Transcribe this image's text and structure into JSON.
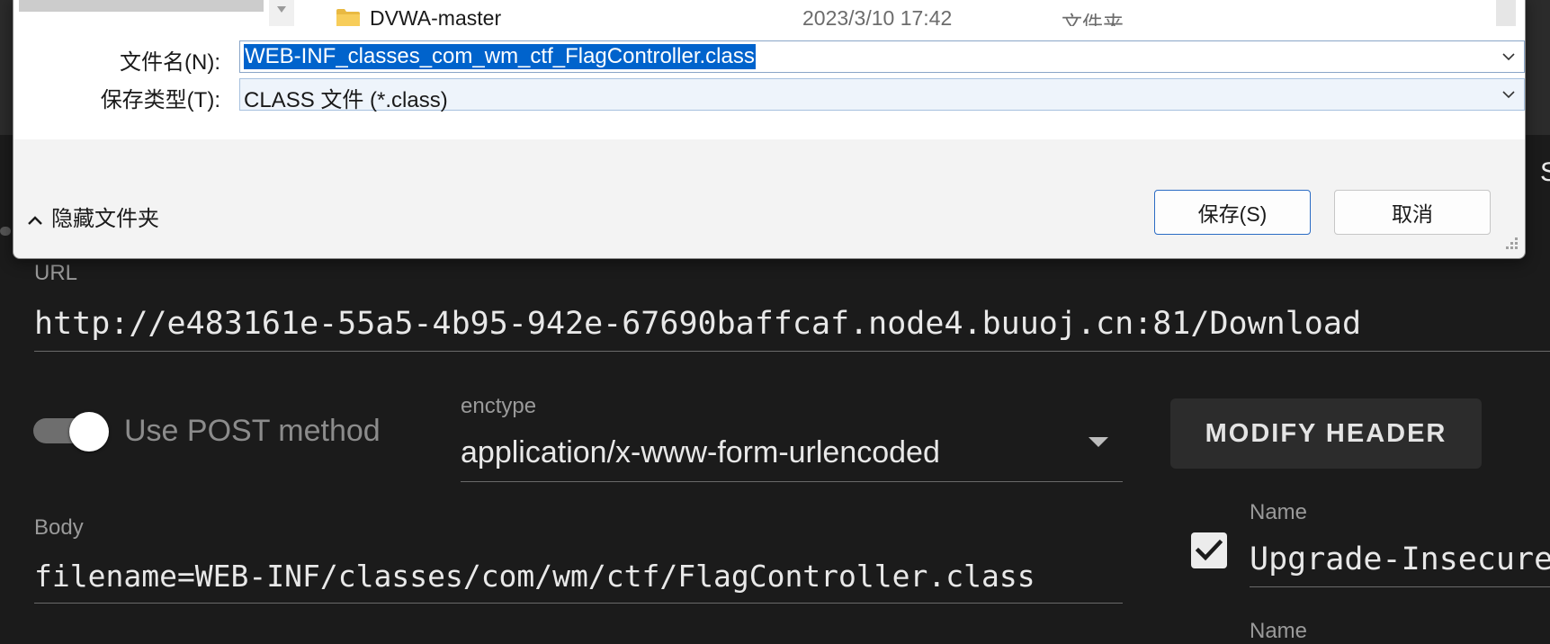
{
  "dialog": {
    "file_row": {
      "name": "DVWA-master",
      "date": "2023/3/10 17:42",
      "type": "文件夹"
    },
    "filename_label": "文件名(N):",
    "filename_value": "WEB-INF_classes_com_wm_ctf_FlagController.class",
    "savetype_label": "保存类型(T):",
    "savetype_value": "CLASS 文件 (*.class)",
    "hide_folders": "隐藏文件夹",
    "save_button": "保存(S)",
    "cancel_button": "取消"
  },
  "request": {
    "url_label": "URL",
    "url_value": "http://e483161e-55a5-4b95-942e-67690baffcaf.node4.buuoj.cn:81/Download",
    "post_toggle_label": "Use POST method",
    "post_enabled": true,
    "enctype_label": "enctype",
    "enctype_value": "application/x-www-form-urlencoded",
    "modify_header_button": "MODIFY HEADER",
    "body_label": "Body",
    "body_value": "filename=WEB-INF/classes/com/wm/ctf/FlagController.class"
  },
  "headers": [
    {
      "label": "Name",
      "value": "Upgrade-Insecure",
      "checked": true
    },
    {
      "label": "Name"
    }
  ],
  "edge_letter": "S",
  "colors": {
    "accent": "#0063cc",
    "dark_bg": "#1b1b1b",
    "dialog_bg": "#f3f3f3"
  }
}
